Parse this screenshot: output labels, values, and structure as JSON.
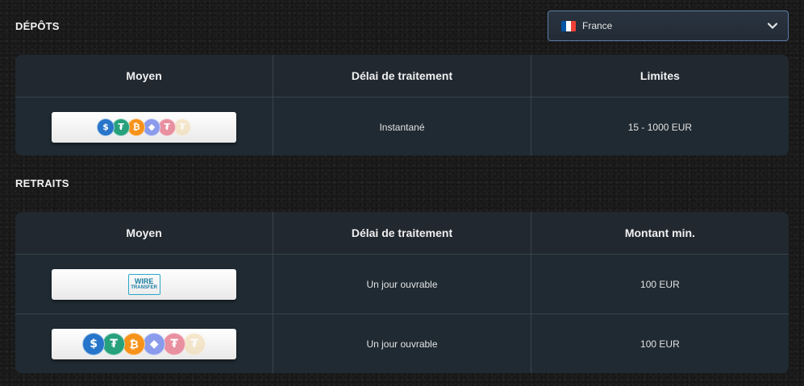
{
  "deposits": {
    "title": "DÉPÔTS",
    "headers": [
      "Moyen",
      "Délai de traitement",
      "Limites"
    ],
    "rows": [
      {
        "method": "crypto",
        "time": "Instantané",
        "limit": "15 - 1000 EUR"
      }
    ]
  },
  "country_select": {
    "value": "France",
    "flag_colors": [
      "#0055a4",
      "#ffffff",
      "#ef4135"
    ]
  },
  "withdrawals": {
    "title": "RETRAITS",
    "headers": [
      "Moyen",
      "Délai de traitement",
      "Montant min."
    ],
    "rows": [
      {
        "method": "wire-transfer",
        "logo_line1": "WIRE",
        "logo_line2": "TRANSFER",
        "time": "Un jour ouvrable",
        "amount": "100 EUR"
      },
      {
        "method": "crypto",
        "time": "Un jour ouvrable",
        "amount": "100 EUR"
      }
    ]
  },
  "crypto_icons": [
    {
      "name": "usdc-icon",
      "glyph": "$",
      "color": "#2775ca"
    },
    {
      "name": "tether-icon",
      "glyph": "₮",
      "color": "#26a17b"
    },
    {
      "name": "bitcoin-icon",
      "glyph": "₿",
      "color": "#f7931a"
    },
    {
      "name": "ethereum-icon",
      "glyph": "◆",
      "color": "#8a9bec"
    },
    {
      "name": "tether-icon",
      "glyph": "₮",
      "color": "#e88fa0"
    },
    {
      "name": "coin-icon",
      "glyph": "₮",
      "color": "#f3d9a8"
    }
  ]
}
